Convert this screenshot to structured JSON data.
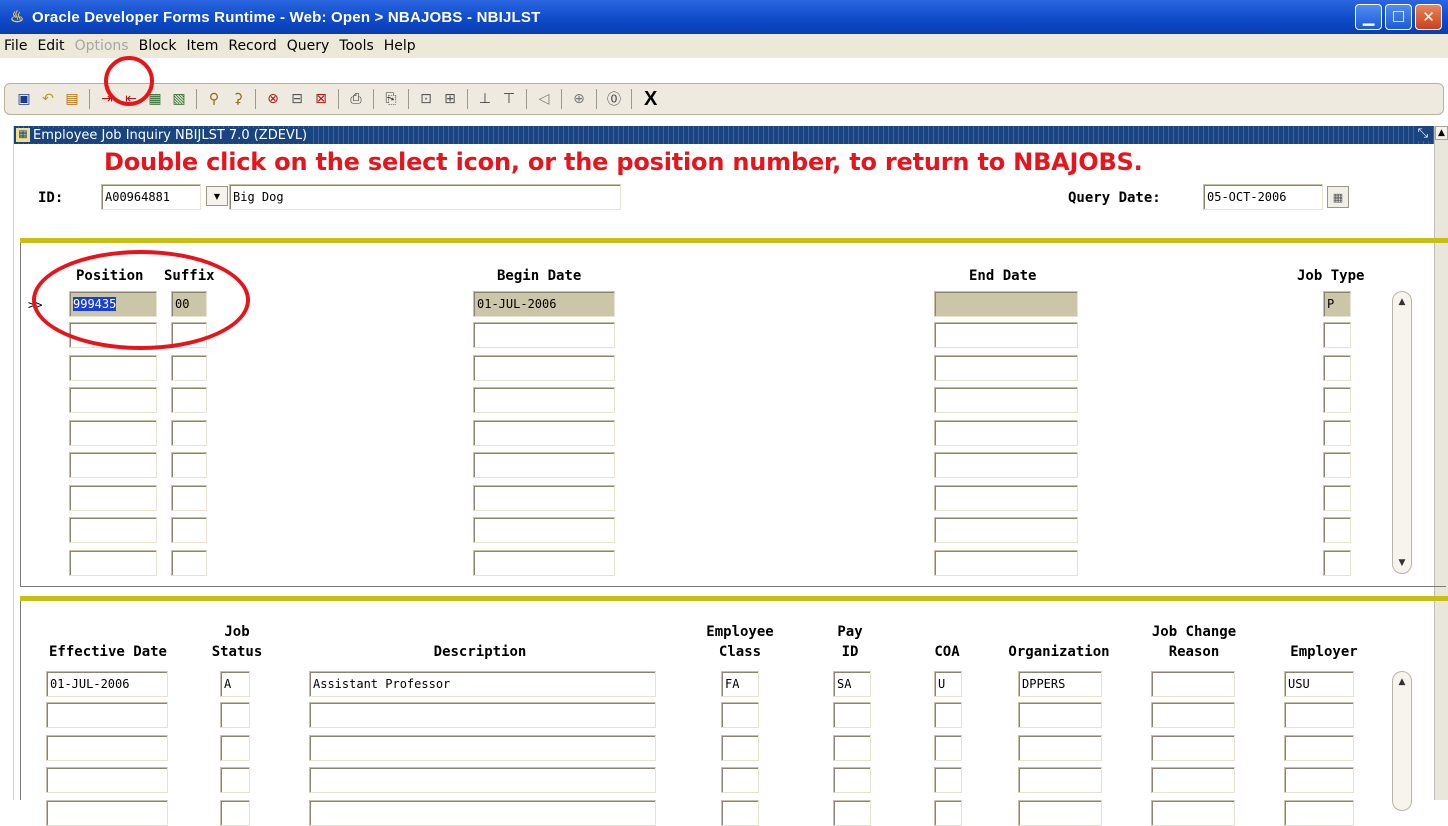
{
  "window": {
    "title": "Oracle Developer Forms Runtime - Web:  Open > NBAJOBS - NBIJLST",
    "app_icon": "java-cup-icon",
    "controls": [
      "minimize-icon",
      "maximize-icon",
      "close-icon"
    ]
  },
  "menu": {
    "items": [
      {
        "label": "File",
        "enabled": true
      },
      {
        "label": "Edit",
        "enabled": true
      },
      {
        "label": "Options",
        "enabled": false
      },
      {
        "label": "Block",
        "enabled": true
      },
      {
        "label": "Item",
        "enabled": true
      },
      {
        "label": "Record",
        "enabled": true
      },
      {
        "label": "Query",
        "enabled": true
      },
      {
        "label": "Tools",
        "enabled": true
      },
      {
        "label": "Help",
        "enabled": true
      }
    ]
  },
  "toolbar": {
    "exit_label": "X"
  },
  "form": {
    "window_title": "Employee Job Inquiry  NBIJLST  7.0  (ZDEVL)",
    "instruction": "Double click on the select icon, or the position number, to return to NBAJOBS.",
    "key_block": {
      "id_label": "ID:",
      "id_value": "A00964881",
      "name_value": "Big Dog",
      "query_date_label": "Query Date:",
      "query_date_value": "05-OCT-2006"
    },
    "positions": {
      "headers": {
        "position": "Position",
        "suffix": "Suffix",
        "begin_date": "Begin Date",
        "end_date": "End Date",
        "job_type": "Job Type"
      },
      "current_marker": ">>",
      "rows": [
        {
          "position": "999435",
          "suffix": "00",
          "begin_date": "01-JUL-2006",
          "end_date": "",
          "job_type": "P"
        }
      ],
      "empty_rows": 8
    },
    "details": {
      "headers": {
        "effective_date": "Effective Date",
        "job": "Job",
        "status": "Status",
        "description": "Description",
        "employee": "Employee",
        "class": "Class",
        "pay": "Pay",
        "id": "ID",
        "coa": "COA",
        "organization": "Organization",
        "job_change": "Job Change",
        "reason": "Reason",
        "employer": "Employer"
      },
      "rows": [
        {
          "effective_date": "01-JUL-2006",
          "status": "A",
          "description": "Assistant Professor",
          "employee_class": "FA",
          "pay_id": "SA",
          "coa": "U",
          "organization": "DPPERS",
          "reason": "",
          "employer": "USU"
        }
      ],
      "empty_rows": 4
    }
  },
  "colors": {
    "titlebar": "#0d49c8",
    "form_header": "#19447f",
    "instruction_red": "#e8141b",
    "gold_rule": "#c8bf14",
    "filled_field": "#ccc6a8",
    "selection": "#1a3fd6"
  }
}
